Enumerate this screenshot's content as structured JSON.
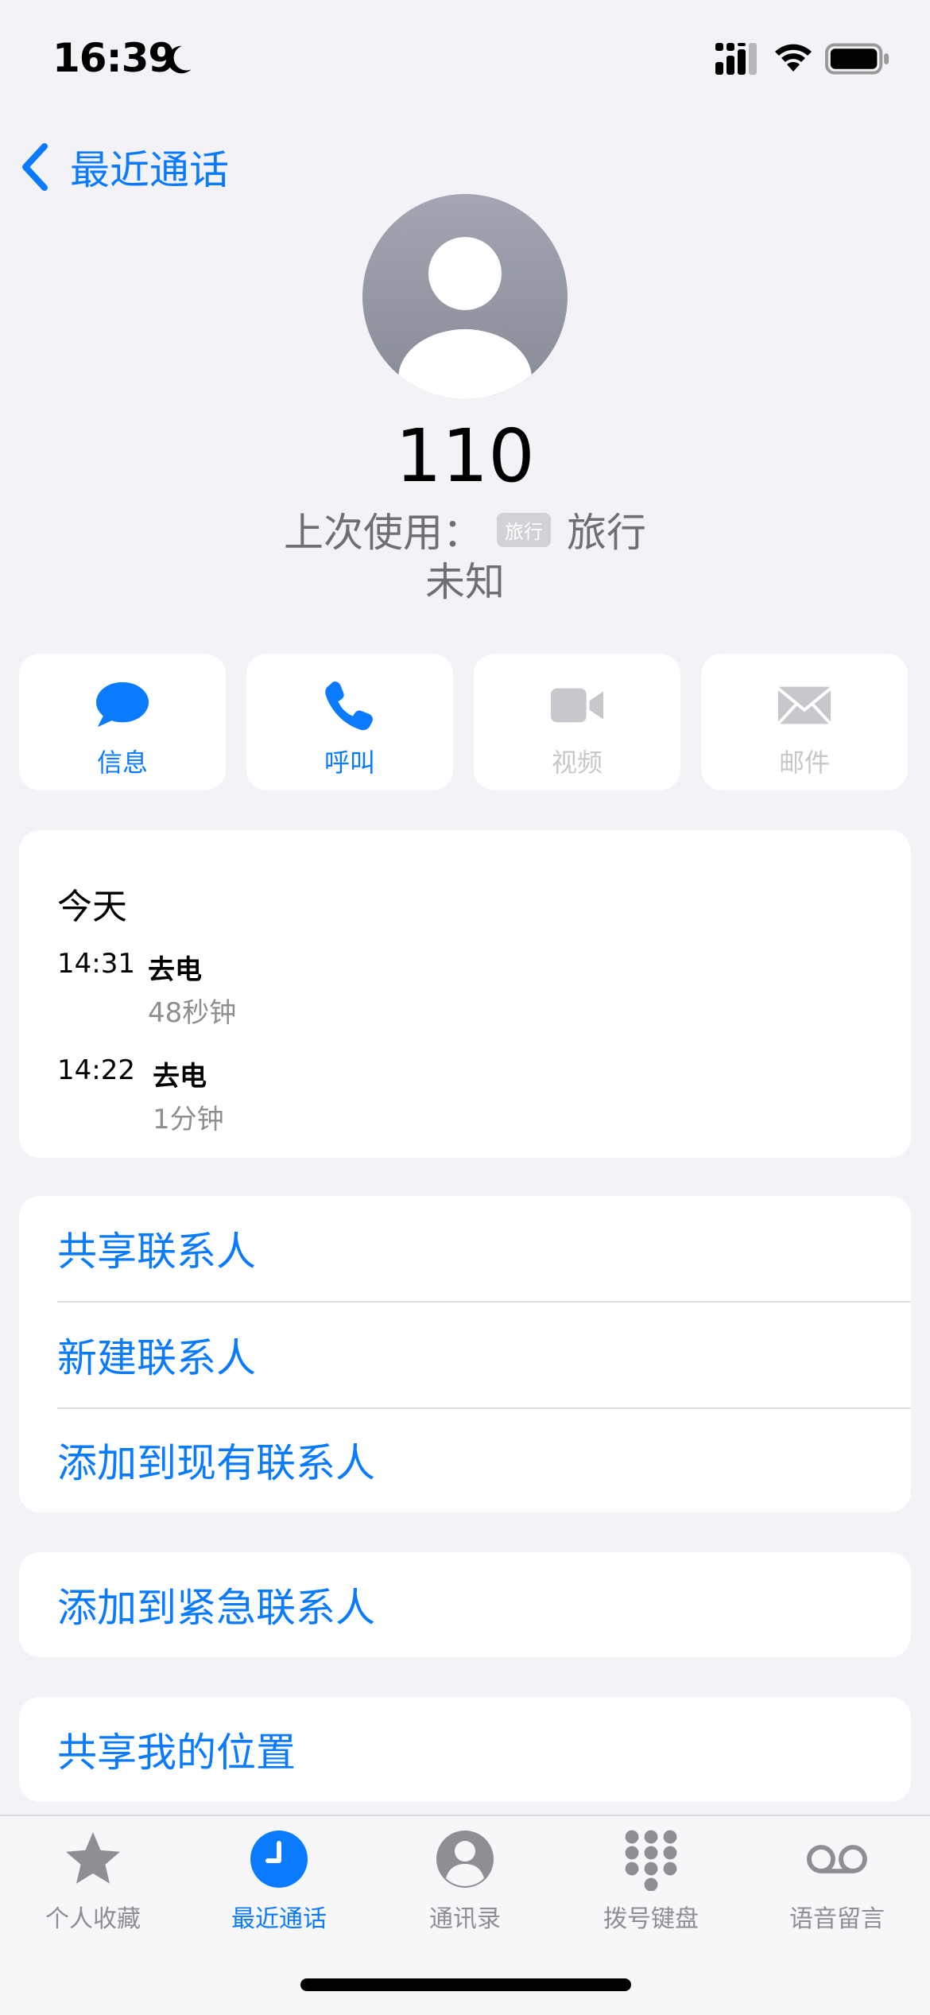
{
  "status_bar": {
    "time": "16:39"
  },
  "nav": {
    "back_label": "最近通话"
  },
  "contact": {
    "number": "110",
    "last_used_prefix": "上次使用：",
    "line_badge": "旅行",
    "line_name": "旅行",
    "status": "未知"
  },
  "actions": [
    {
      "label": "信息",
      "icon": "message-icon",
      "enabled": true
    },
    {
      "label": "呼叫",
      "icon": "phone-icon",
      "enabled": true
    },
    {
      "label": "视频",
      "icon": "video-icon",
      "enabled": false
    },
    {
      "label": "邮件",
      "icon": "mail-icon",
      "enabled": false
    }
  ],
  "history": {
    "day": "今天",
    "calls": [
      {
        "time": "14:31",
        "type": "去电",
        "duration": "48秒钟"
      },
      {
        "time": "14:22",
        "type": "去电",
        "duration": "1分钟"
      }
    ]
  },
  "options": [
    "共享联系人",
    "新建联系人",
    "添加到现有联系人"
  ],
  "emergency_option": "添加到紧急联系人",
  "location_option": "共享我的位置",
  "tabs": [
    {
      "label": "个人收藏",
      "icon": "star-icon",
      "active": false
    },
    {
      "label": "最近通话",
      "icon": "clock-icon",
      "active": true
    },
    {
      "label": "通讯录",
      "icon": "person-icon",
      "active": false
    },
    {
      "label": "拨号键盘",
      "icon": "keypad-icon",
      "active": false
    },
    {
      "label": "语音留言",
      "icon": "voicemail-icon",
      "active": false
    }
  ],
  "colors": {
    "accent": "#0a7aff",
    "background": "#f2f2f7",
    "disabled": "#c7c7cc",
    "secondary_text": "#8e8e93"
  }
}
